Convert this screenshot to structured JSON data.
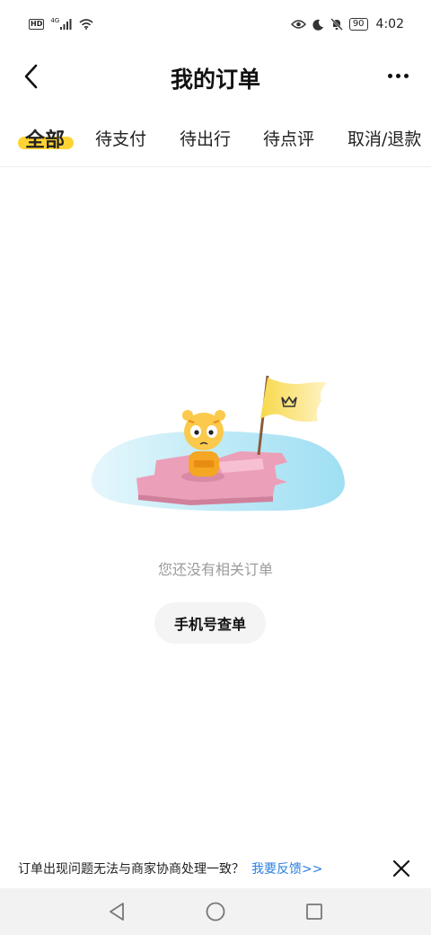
{
  "status_bar": {
    "hd": "HD",
    "network": "4G",
    "battery": "90",
    "time": "4:02",
    "icons": [
      "hd-icon",
      "signal-icon",
      "wifi-icon",
      "eye-icon",
      "moon-icon",
      "mute-bell-icon",
      "battery-icon"
    ]
  },
  "header": {
    "title": "我的订单",
    "back_icon": "chevron-left-icon",
    "more_icon": "more-dots-icon"
  },
  "tabs": [
    {
      "label": "全部",
      "active": true
    },
    {
      "label": "待支付",
      "active": false
    },
    {
      "label": "待出行",
      "active": false
    },
    {
      "label": "待点评",
      "active": false
    },
    {
      "label": "取消/退款",
      "active": false
    }
  ],
  "empty_state": {
    "message": "您还没有相关订单",
    "button_label": "手机号查单"
  },
  "feedback": {
    "text": "订单出现问题无法与商家协商处理一致？",
    "link": "我要反馈>>",
    "close_icon": "close-icon"
  },
  "colors": {
    "accent_yellow": "#ffd333",
    "link_blue": "#2b7fe0",
    "muted_text": "#9b9b9b",
    "nav_bg": "#f2f2f2"
  },
  "nav_bar": {
    "icons": [
      "back-triangle-icon",
      "home-circle-icon",
      "recents-square-icon"
    ]
  }
}
